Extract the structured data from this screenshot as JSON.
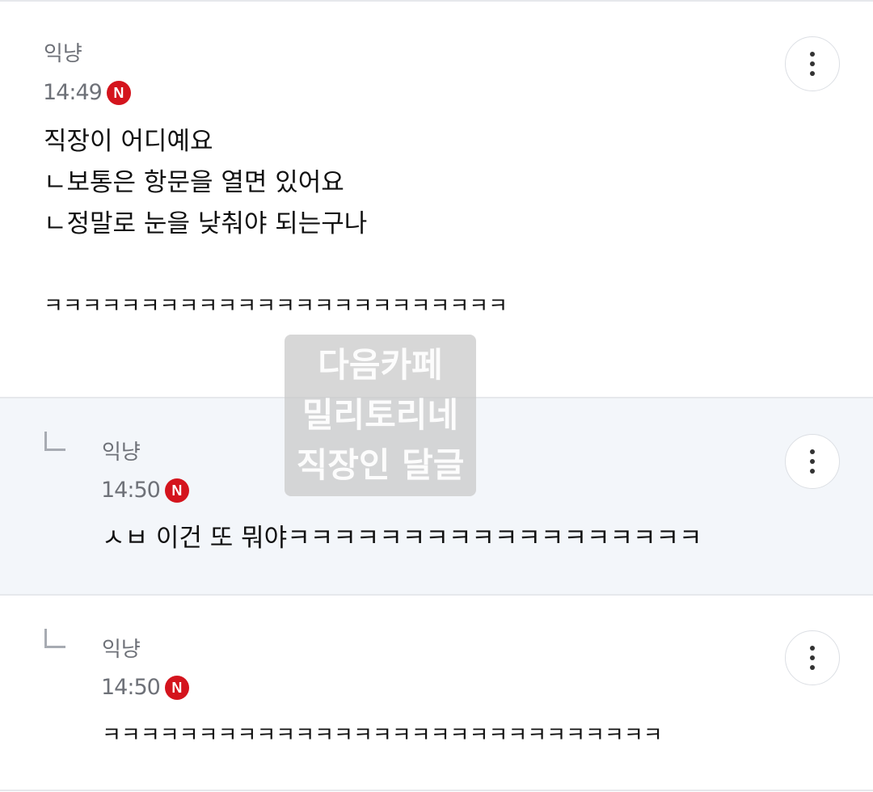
{
  "comments": [
    {
      "author": "익냥",
      "time": "14:49",
      "badge": "N",
      "lines": [
        "직장이 어디예요",
        "ㄴ보통은 항문을 열면 있어요",
        "ㄴ정말로 눈을 낮춰야 되는구나",
        "",
        "ㅋㅋㅋㅋㅋㅋㅋㅋㅋㅋㅋㅋㅋㅋㅋㅋㅋㅋㅋㅋㅋㅋㅋㅋ"
      ]
    },
    {
      "author": "익냥",
      "time": "14:50",
      "badge": "N",
      "lines": [
        "ㅅㅂ 이건 또 뭐야ㅋㅋㅋㅋㅋㅋㅋㅋㅋㅋㅋㅋㅋㅋㅋㅋㅋㅋ"
      ]
    },
    {
      "author": "익냥",
      "time": "14:50",
      "badge": "N",
      "lines": [
        "ㅋㅋㅋㅋㅋㅋㅋㅋㅋㅋㅋㅋㅋㅋㅋㅋㅋㅋㅋㅋㅋㅋㅋㅋㅋㅋㅋㅋㅋ"
      ]
    }
  ],
  "watermark": {
    "lines": [
      "다음카페",
      "밀리토리네",
      "직장인 달글"
    ]
  },
  "icons": {
    "more": "more-vertical-icon",
    "reply": "reply-arrow-icon"
  },
  "colors": {
    "badge": "#d4141d",
    "highlight_background": "#f3f6fa",
    "meta_text": "#6e7178"
  }
}
